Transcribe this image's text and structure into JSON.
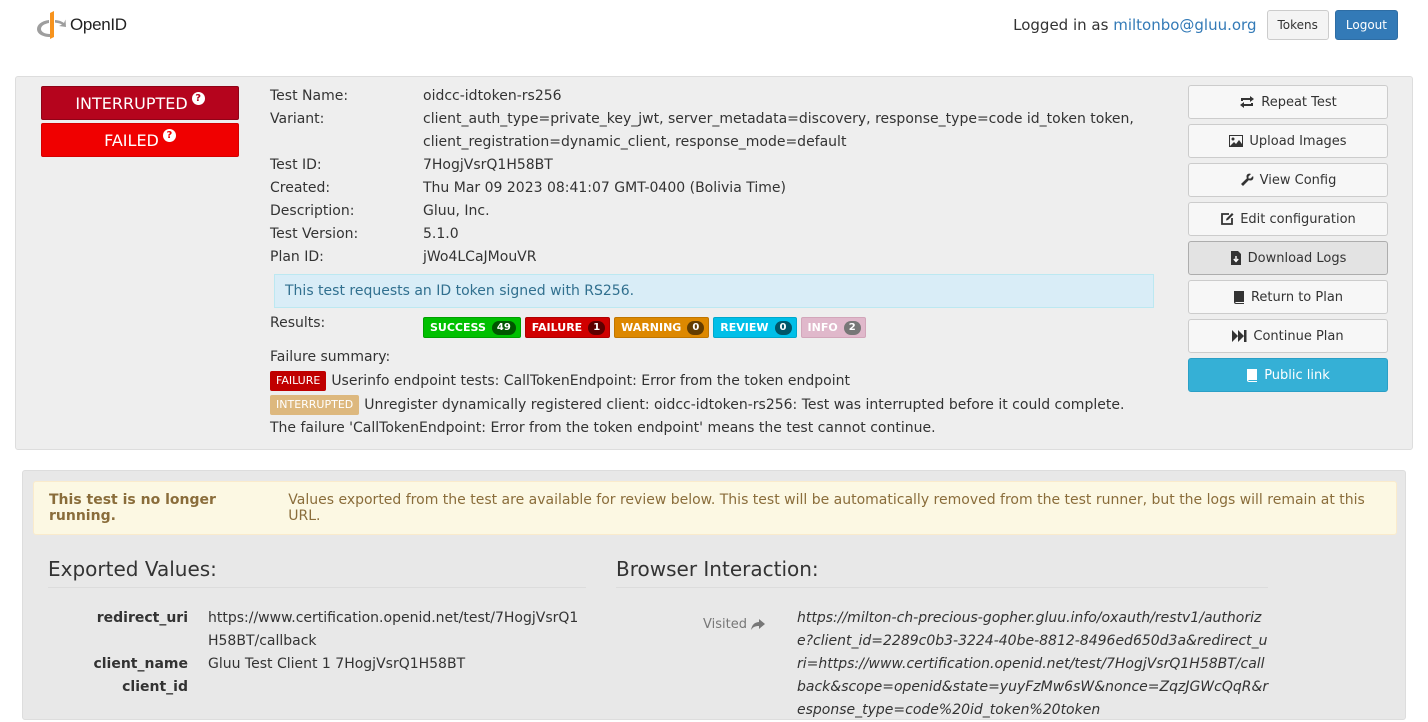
{
  "header": {
    "logo_text": "OpenID",
    "logged_in_prefix": "Logged in as ",
    "user_email": "miltonbo@gluu.org",
    "tokens_label": "Tokens",
    "logout_label": "Logout"
  },
  "status": {
    "interrupted_label": "INTERRUPTED",
    "failed_label": "FAILED",
    "help_glyph": "?"
  },
  "test_info": {
    "name_label": "Test Name:",
    "name_value": "oidcc-idtoken-rs256",
    "variant_label": "Variant:",
    "variant_line1": "client_auth_type=private_key_jwt, server_metadata=discovery, response_type=code id_token token,",
    "variant_line2": "client_registration=dynamic_client, response_mode=default",
    "id_label": "Test ID:",
    "id_value": "7HogjVsrQ1H58BT",
    "created_label": "Created:",
    "created_value": "Thu Mar 09 2023 08:41:07 GMT-0400 (Bolivia Time)",
    "description_label": "Description:",
    "description_value": "Gluu, Inc.",
    "version_label": "Test Version:",
    "version_value": "5.1.0",
    "plan_label": "Plan ID:",
    "plan_value": "jWo4LCaJMouVR",
    "summary_text": "This test requests an ID token signed with RS256.",
    "results_label": "Results:",
    "failure_summary_label": "Failure summary:"
  },
  "results": {
    "success": {
      "label": "SUCCESS",
      "count": "49"
    },
    "failure": {
      "label": "FAILURE",
      "count": "1"
    },
    "warning": {
      "label": "WARNING",
      "count": "0"
    },
    "review": {
      "label": "REVIEW",
      "count": "0"
    },
    "info": {
      "label": "INFO",
      "count": "2"
    }
  },
  "failures": [
    {
      "tag": "FAILURE",
      "text": "Userinfo endpoint tests: CallTokenEndpoint: Error from the token endpoint"
    },
    {
      "tag": "INTERRUPTED",
      "text": "Unregister dynamically registered client: oidcc-idtoken-rs256: Test was interrupted before it could complete. The failure 'CallTokenEndpoint: Error from the token endpoint' means the test cannot continue."
    }
  ],
  "actions": {
    "repeat": "Repeat Test",
    "upload": "Upload Images",
    "view_config": "View Config",
    "edit_config": "Edit configuration",
    "download_logs": "Download Logs",
    "return_plan": "Return to Plan",
    "continue_plan": "Continue Plan",
    "public_link": "Public link"
  },
  "notice": {
    "bold": "This test is no longer running.",
    "text": "Values exported from the test are available for review below. This test will be automatically removed from the test runner, but the logs will remain at this URL."
  },
  "exported": {
    "title": "Exported Values:",
    "rows": [
      {
        "key": "redirect_uri",
        "value": "https://www.certification.openid.net/test/7HogjVsrQ1H58BT/callback"
      },
      {
        "key": "client_name",
        "value": "Gluu Test Client 1 7HogjVsrQ1H58BT"
      },
      {
        "key": "client_id",
        "value": ""
      }
    ]
  },
  "browser": {
    "title": "Browser Interaction:",
    "visited_label": "Visited",
    "url": "https://milton-ch-precious-gopher.gluu.info/oxauth/restv1/authorize?client_id=2289c0b3-3224-40be-8812-8496ed650d3a&redirect_uri=https://www.certification.openid.net/test/7HogjVsrQ1H58BT/callback&scope=openid&state=yuyFzMw6sW&nonce=ZqzJGWcQqR&response_type=code%20id_token%20token"
  },
  "colors": {
    "interrupted": "#b5041d",
    "failed": "#f00000",
    "primary": "#337ab7",
    "public_link": "#35b0d6"
  }
}
